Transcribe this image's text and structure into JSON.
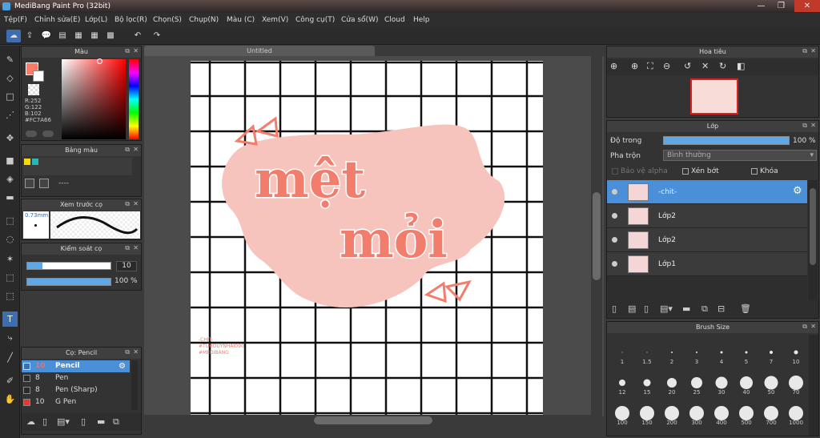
{
  "window": {
    "title": "MediBang Paint Pro (32bit)",
    "minimize": "—",
    "restore": "❐",
    "close": "✕"
  },
  "menu": [
    "Tệp(F)",
    "Chỉnh sửa(E)",
    "Lớp(L)",
    "Bộ lọc(R)",
    "Chọn(S)",
    "Chụp(N)",
    "Màu (C)",
    "Xem(V)",
    "Công cụ(T)",
    "Cửa sổ(W)",
    "Cloud",
    "Help"
  ],
  "canvas": {
    "tab": "Untitled"
  },
  "color_panel": {
    "title": "Màu",
    "r": "R:252",
    "g": "G:122",
    "b": "B:102",
    "hex": "#FC7A66",
    "primary": "#FC7A66"
  },
  "palette_panel": {
    "title": "Bảng màu",
    "swatches": [
      "#f5d90a",
      "#2bb5b5"
    ],
    "name": "----"
  },
  "brush_preview": {
    "title": "Xem trước cọ",
    "size": "0.73mm"
  },
  "brush_control": {
    "title": "Kiểm soát cọ",
    "size": "10",
    "opacity": "100 %"
  },
  "brush_list": {
    "title": "Cọ: Pencil",
    "items": [
      {
        "size": "10",
        "name": "Pencil",
        "color": "#3a6fb0",
        "selected": true
      },
      {
        "size": "8",
        "name": "Pen",
        "color": "#2a2a2a",
        "selected": false
      },
      {
        "size": "8",
        "name": "Pen (Sharp)",
        "color": "#2a2a2a",
        "selected": false
      },
      {
        "size": "10",
        "name": "G Pen",
        "color": "#e53535",
        "selected": false
      }
    ]
  },
  "navigator": {
    "title": "Hoa tiêu"
  },
  "layers_panel": {
    "title": "Lớp",
    "opacity_label": "Độ trong",
    "opacity_value": "100 %",
    "blend_label": "Pha trộn",
    "blend_value": "Bình thường",
    "protect_alpha": "Bảo vệ alpha",
    "clipping": "Xén bớt",
    "lock": "Khóa",
    "layers": [
      {
        "name": "-chit-",
        "selected": true
      },
      {
        "name": "Lớp2",
        "selected": false
      },
      {
        "name": "Lớp2",
        "selected": false
      },
      {
        "name": "Lớp1",
        "selected": false
      }
    ]
  },
  "brush_size_panel": {
    "title": "Brush Size",
    "sizes": [
      "1",
      "1.5",
      "2",
      "3",
      "4",
      "5",
      "7",
      "10",
      "12",
      "15",
      "20",
      "25",
      "30",
      "40",
      "50",
      "70",
      "100",
      "150",
      "200",
      "300",
      "400",
      "500",
      "700",
      "1000"
    ]
  },
  "artwork": {
    "line1": "mệt",
    "line2": "mỏi",
    "caption1": "-CHIT-",
    "caption2": "#TUHOUYNHAI090",
    "caption3": "#MEDIBANG"
  },
  "colors": {
    "accent": "#4a90d9",
    "panel": "#333333",
    "pink": "#f4c2bb",
    "coral": "#f27d6d"
  }
}
